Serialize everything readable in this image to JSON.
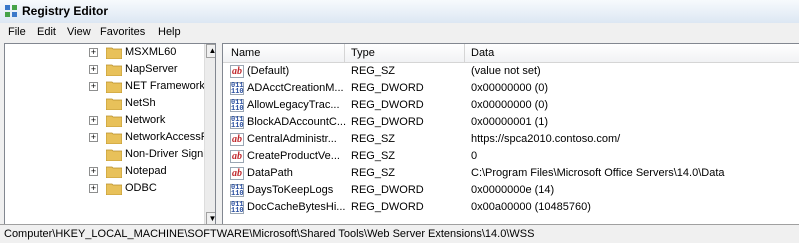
{
  "window": {
    "title": "Registry Editor"
  },
  "menu": [
    "File",
    "Edit",
    "View",
    "Favorites",
    "Help"
  ],
  "tree": {
    "items": [
      {
        "label": "MSXML60",
        "expand": "+"
      },
      {
        "label": "NapServer",
        "expand": "+"
      },
      {
        "label": "NET Framework",
        "expand": "+"
      },
      {
        "label": "NetSh",
        "expand": ""
      },
      {
        "label": "Network",
        "expand": "+"
      },
      {
        "label": "NetworkAccessP",
        "expand": "+"
      },
      {
        "label": "Non-Driver Signi",
        "expand": ""
      },
      {
        "label": "Notepad",
        "expand": "+"
      },
      {
        "label": "ODBC",
        "expand": "+"
      }
    ]
  },
  "list": {
    "columns": [
      "Name",
      "Type",
      "Data"
    ],
    "rows": [
      {
        "icon": "sz",
        "name": "(Default)",
        "type": "REG_SZ",
        "data": "(value not set)"
      },
      {
        "icon": "dword",
        "name": "ADAcctCreationM...",
        "type": "REG_DWORD",
        "data": "0x00000000 (0)"
      },
      {
        "icon": "dword",
        "name": "AllowLegacyTrac...",
        "type": "REG_DWORD",
        "data": "0x00000000 (0)"
      },
      {
        "icon": "dword",
        "name": "BlockADAccountC...",
        "type": "REG_DWORD",
        "data": "0x00000001 (1)"
      },
      {
        "icon": "sz",
        "name": "CentralAdministr...",
        "type": "REG_SZ",
        "data": "https://spca2010.contoso.com/"
      },
      {
        "icon": "sz",
        "name": "CreateProductVe...",
        "type": "REG_SZ",
        "data": "0"
      },
      {
        "icon": "sz",
        "name": "DataPath",
        "type": "REG_SZ",
        "data": "C:\\Program Files\\Microsoft Office Servers\\14.0\\Data"
      },
      {
        "icon": "dword",
        "name": "DaysToKeepLogs",
        "type": "REG_DWORD",
        "data": "0x0000000e (14)"
      },
      {
        "icon": "dword",
        "name": "DocCacheBytesHi...",
        "type": "REG_DWORD",
        "data": "0x00a00000 (10485760)"
      }
    ]
  },
  "statusbar": {
    "path": "Computer\\HKEY_LOCAL_MACHINE\\SOFTWARE\\Microsoft\\Shared Tools\\Web Server Extensions\\14.0\\WSS"
  },
  "colors": {
    "folder": "#e8c15a",
    "sz_icon": "#c0282d",
    "dword_icon": "#2a4fa0"
  }
}
